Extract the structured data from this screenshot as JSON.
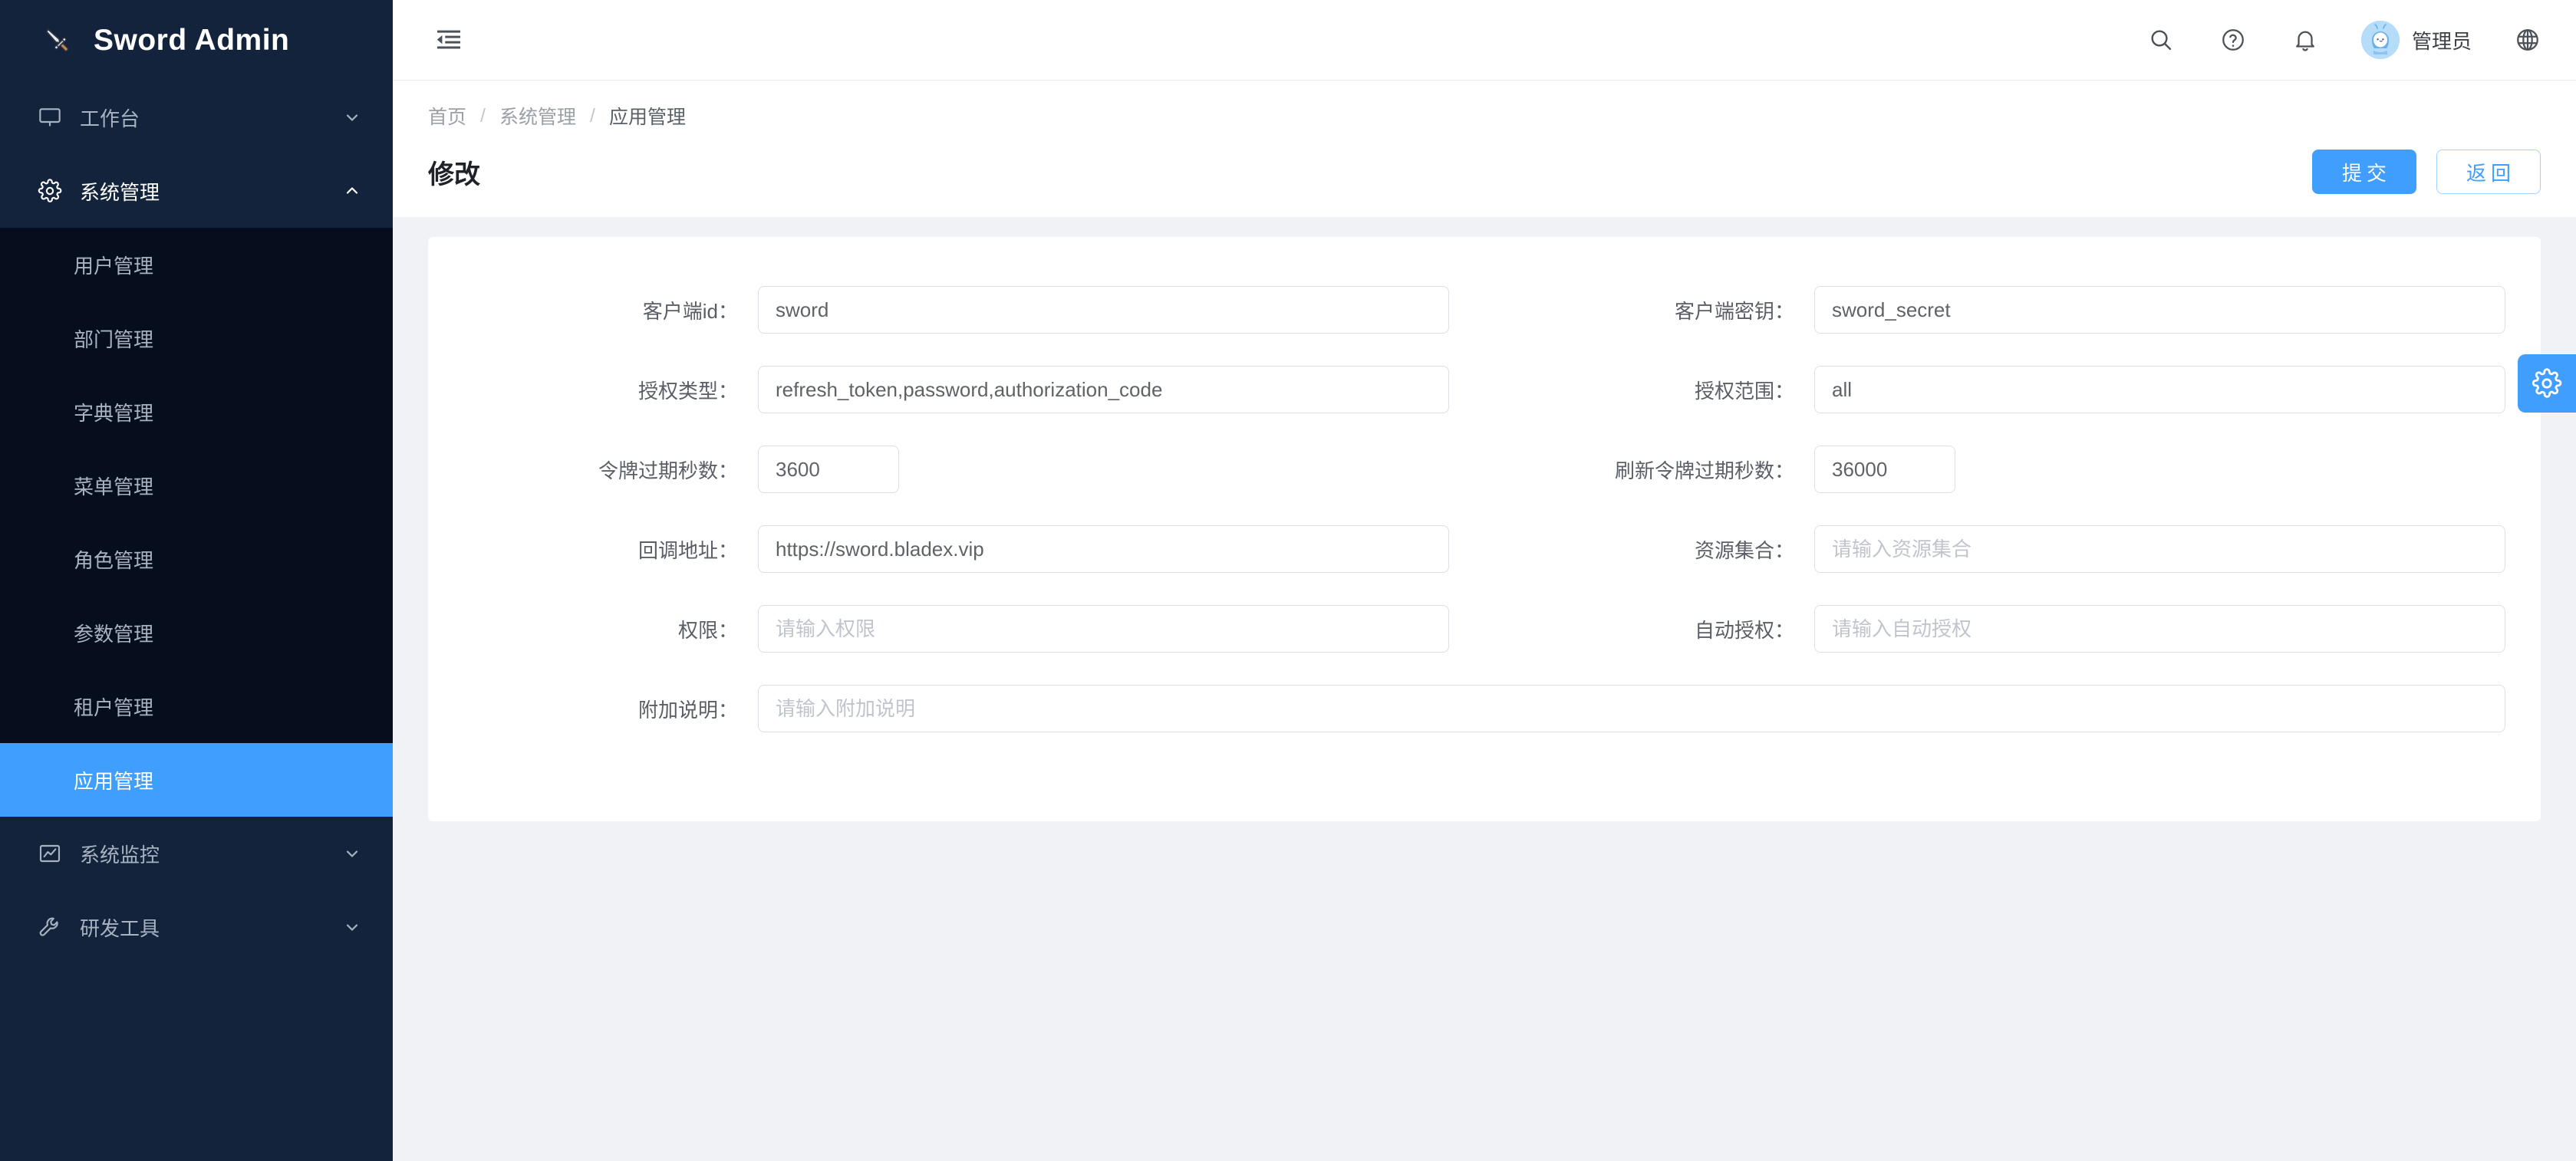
{
  "brand": {
    "logo_icon": "sword-icon",
    "logo_glyph": "🗡",
    "title": "Sword Admin"
  },
  "colors": {
    "sidebar_bg": "#14233c",
    "submenu_bg": "#060e1e",
    "accent": "#409eff",
    "page_bg": "#f0f2f5",
    "card_bg": "#ffffff"
  },
  "sidebar": {
    "groups": [
      {
        "label": "工作台",
        "icon": "monitor-icon",
        "expanded": false,
        "chevron": "chevron-down-icon",
        "items": []
      },
      {
        "label": "系统管理",
        "icon": "gear-icon",
        "expanded": true,
        "chevron": "chevron-up-icon",
        "items": [
          {
            "label": "用户管理",
            "active": false
          },
          {
            "label": "部门管理",
            "active": false
          },
          {
            "label": "字典管理",
            "active": false
          },
          {
            "label": "菜单管理",
            "active": false
          },
          {
            "label": "角色管理",
            "active": false
          },
          {
            "label": "参数管理",
            "active": false
          },
          {
            "label": "租户管理",
            "active": false
          },
          {
            "label": "应用管理",
            "active": true
          }
        ]
      },
      {
        "label": "系统监控",
        "icon": "chart-icon",
        "expanded": false,
        "chevron": "chevron-down-icon",
        "items": []
      },
      {
        "label": "研发工具",
        "icon": "wrench-icon",
        "expanded": false,
        "chevron": "chevron-down-icon",
        "items": []
      }
    ]
  },
  "topbar": {
    "fold_icon": "fold-menu-icon",
    "icons": [
      {
        "name": "search-icon"
      },
      {
        "name": "help-icon"
      },
      {
        "name": "bell-icon"
      }
    ],
    "user_name": "管理员",
    "avatar_icon": "avatar",
    "language_icon": "globe-icon"
  },
  "page": {
    "breadcrumb": [
      {
        "label": "首页",
        "current": false
      },
      {
        "label": "系统管理",
        "current": false
      },
      {
        "label": "应用管理",
        "current": true
      }
    ],
    "breadcrumb_separator": "/",
    "title": "修改",
    "submit_label": "提交",
    "back_label": "返回"
  },
  "form": {
    "fields": [
      {
        "label": "客户端id：",
        "value": "sword",
        "placeholder": "",
        "width": "half",
        "size": "wide"
      },
      {
        "label": "客户端密钥：",
        "value": "sword_secret",
        "placeholder": "",
        "width": "half",
        "size": "wide"
      },
      {
        "label": "授权类型：",
        "value": "refresh_token,password,authorization_code",
        "placeholder": "",
        "width": "half",
        "size": "wide"
      },
      {
        "label": "授权范围：",
        "value": "all",
        "placeholder": "",
        "width": "half",
        "size": "wide"
      },
      {
        "label": "令牌过期秒数：",
        "value": "3600",
        "placeholder": "",
        "width": "half",
        "size": "narrow"
      },
      {
        "label": "刷新令牌过期秒数：",
        "value": "36000",
        "placeholder": "",
        "width": "half",
        "size": "narrow"
      },
      {
        "label": "回调地址：",
        "value": "https://sword.bladex.vip",
        "placeholder": "",
        "width": "half",
        "size": "wide"
      },
      {
        "label": "资源集合：",
        "value": "",
        "placeholder": "请输入资源集合",
        "width": "half",
        "size": "wide"
      },
      {
        "label": "权限：",
        "value": "",
        "placeholder": "请输入权限",
        "width": "half",
        "size": "wide"
      },
      {
        "label": "自动授权：",
        "value": "",
        "placeholder": "请输入自动授权",
        "width": "half",
        "size": "wide"
      },
      {
        "label": "附加说明：",
        "value": "",
        "placeholder": "请输入附加说明",
        "width": "full",
        "size": "wide"
      }
    ]
  },
  "float_settings": {
    "icon": "gear-icon"
  }
}
